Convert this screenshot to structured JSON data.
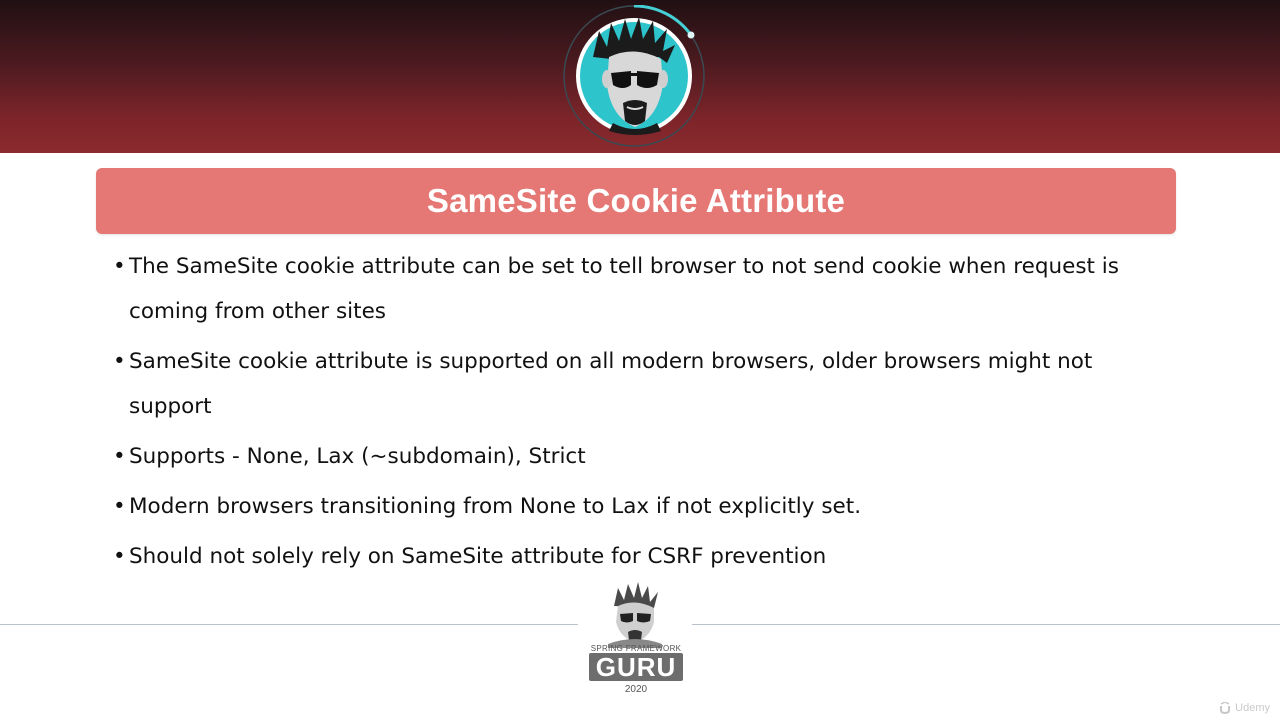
{
  "slide": {
    "title": "SameSite Cookie Attribute",
    "bullets": [
      "The SameSite cookie attribute can be set to tell browser to not send cookie when request is coming from other sites",
      "SameSite cookie attribute is supported on all modern browsers, older browsers might not support",
      "Supports - None, Lax (~subdomain), Strict",
      "Modern browsers transitioning from None to Lax if not explicitly set.",
      "Should not solely rely on SameSite attribute for CSRF prevention"
    ],
    "bullet_marker": "•"
  },
  "footer_logo": {
    "caption": "SPRING FRAMEWORK",
    "word": "GURU",
    "year": "2020"
  },
  "watermark": {
    "text": "Udemy"
  },
  "colors": {
    "header_dark": "#201013",
    "header_red": "#8c2a2e",
    "title_banner": "#e57874",
    "avatar_bg": "#2ec4cc",
    "ring": "#45d0d6"
  }
}
